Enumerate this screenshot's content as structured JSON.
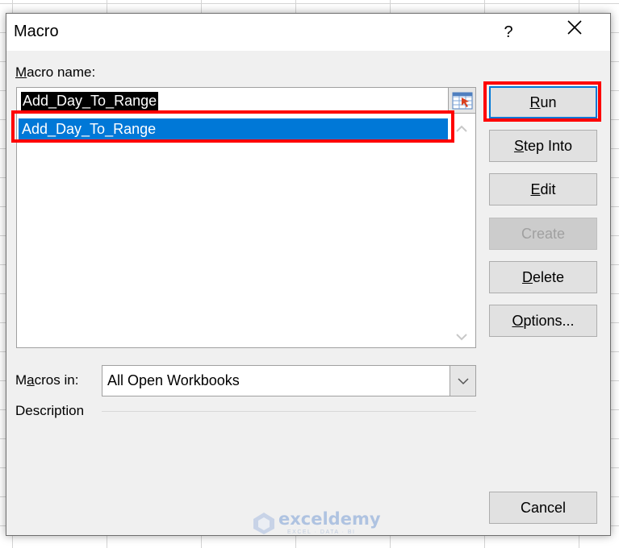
{
  "dialog": {
    "title": "Macro",
    "help_label": "?",
    "close_icon": "close-icon"
  },
  "macro_name": {
    "label_prefix": "M",
    "label_rest": "acro name:",
    "value": "Add_Day_To_Range",
    "ref_icon": "range-selector-icon"
  },
  "macro_list": {
    "items": [
      {
        "label": "Add_Day_To_Range",
        "selected": true
      }
    ]
  },
  "buttons": {
    "run": {
      "accel": "R",
      "rest": "un"
    },
    "step_into": {
      "accel": "S",
      "rest": "tep Into"
    },
    "edit": {
      "accel": "E",
      "rest": "dit"
    },
    "create": {
      "label": "Create",
      "disabled": true
    },
    "delete": {
      "accel": "D",
      "rest": "elete"
    },
    "options": {
      "accel": "O",
      "rest": "ptions..."
    },
    "cancel": {
      "label": "Cancel"
    }
  },
  "macros_in": {
    "label_pre": "M",
    "label_accel": "a",
    "label_post": "cros in:",
    "value": "All Open Workbooks"
  },
  "description": {
    "label": "Description"
  },
  "watermark": {
    "brand": "exceldemy",
    "tagline": "EXCEL · DATA · BI"
  },
  "colors": {
    "selection": "#0078d7",
    "highlight": "#ff0000",
    "dialog_bg": "#f0f0f0"
  }
}
